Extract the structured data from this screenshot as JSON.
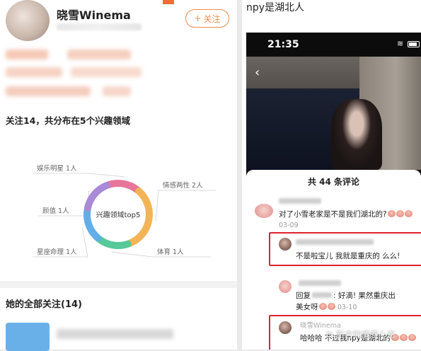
{
  "left": {
    "username": "晓雪Winema",
    "follow_button": {
      "icon": "plus-icon",
      "plus": "+",
      "label": "关注"
    },
    "stat_title": "关注14，共分布在5个兴趣领域",
    "chart_data": {
      "type": "pie",
      "title": "兴趣领域top5",
      "categories": [
        "娱乐明星",
        "情感两性",
        "体育",
        "星座命理",
        "颜值"
      ],
      "values": [
        1,
        2,
        1,
        1,
        1
      ],
      "labels": [
        "娱乐明星 1人",
        "情感两性 2人",
        "体育 1人",
        "星座命理 1人",
        "颜值 1人"
      ],
      "colors": [
        "#e7769a",
        "#f3b457",
        "#56c89a",
        "#62aee8",
        "#a98ad6"
      ]
    },
    "all_follow_title": "她的全部关注(14)"
  },
  "right": {
    "title": "npy是湖北人",
    "status_time": "21:35",
    "comments_title": "共 44 条评论",
    "comments": [
      {
        "text": "对了小雪老家是不是我们湖北的?",
        "date": "03-09"
      },
      {
        "text": "不是啦宝儿 我就是重庆的 么么!"
      },
      {
        "text": "回复",
        "quote": ": 好滴! 果然重庆出",
        "text2": "美女呀",
        "date": "03-10"
      },
      {
        "name": "晓雪Winema",
        "text": "哈哈哈 不过我npy是湖北的"
      }
    ],
    "watermark": "新言的情感心态"
  }
}
